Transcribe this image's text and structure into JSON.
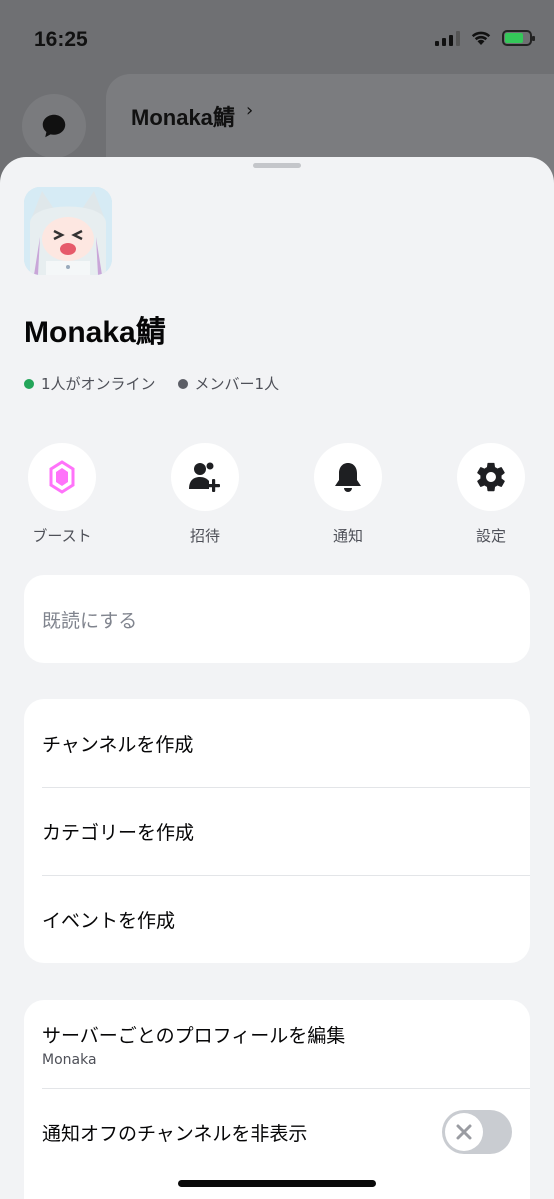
{
  "status_bar": {
    "time": "16:25"
  },
  "background": {
    "server_name": "Monaka鯖",
    "chevron": "›"
  },
  "server": {
    "name": "Monaka鯖",
    "online": "1人がオンライン",
    "members": "メンバー1人",
    "online_color": "#23a559",
    "members_color": "#5c5e66"
  },
  "actions": [
    {
      "label": "ブースト",
      "icon": "boost-gem-icon",
      "color": "#ff73fa"
    },
    {
      "label": "招待",
      "icon": "add-member-icon"
    },
    {
      "label": "通知",
      "icon": "bell-icon"
    },
    {
      "label": "設定",
      "icon": "gear-icon"
    }
  ],
  "mark_read": "既読にする",
  "create_menu": {
    "channel": "チャンネルを作成",
    "category": "カテゴリーを作成",
    "event": "イベントを作成"
  },
  "profile_menu": {
    "edit_profile": "サーバーごとのプロフィールを編集",
    "edit_profile_sub": "Monaka",
    "hide_muted": "通知オフのチャンネルを非表示",
    "hide_muted_enabled": false
  }
}
